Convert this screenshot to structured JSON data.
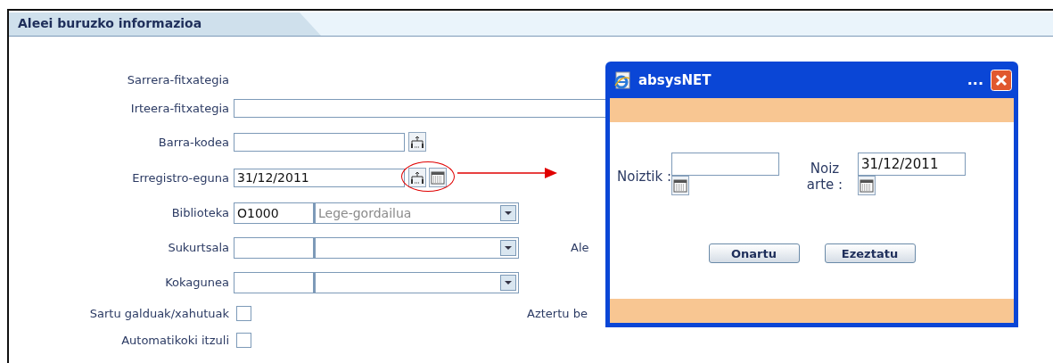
{
  "panel": {
    "title": "Aleei buruzko informazioa"
  },
  "fields": [
    {
      "kind": "label-only",
      "label": "Sarrera-fitxategia"
    },
    {
      "kind": "wide-input",
      "label": "Irteera-fitxategia"
    },
    {
      "kind": "picker-input",
      "label": "Barra-kodea"
    },
    {
      "kind": "date-input",
      "label": "Erregistro-eguna",
      "value": "31/12/2011"
    },
    {
      "kind": "combo",
      "label": "Biblioteka",
      "code": "O1000",
      "value": "Lege-gordailua"
    },
    {
      "kind": "combo",
      "label": "Sukurtsala",
      "side_label": "Ale"
    },
    {
      "kind": "combo",
      "label": "Kokagunea"
    },
    {
      "kind": "checkbox",
      "label": "Sartu galduak/xahutuak",
      "checked": false,
      "side_label": "Aztertu be"
    },
    {
      "kind": "checkbox",
      "label": "Automatikoki itzuli",
      "checked": false
    }
  ],
  "dialog": {
    "title": "absysNET",
    "dots": "...",
    "fields": [
      {
        "label": "Noiztik :"
      },
      {
        "label": "Noiz arte :",
        "value": "31/12/2011"
      }
    ],
    "buttons": [
      "Onartu",
      "Ezeztatu"
    ]
  }
}
